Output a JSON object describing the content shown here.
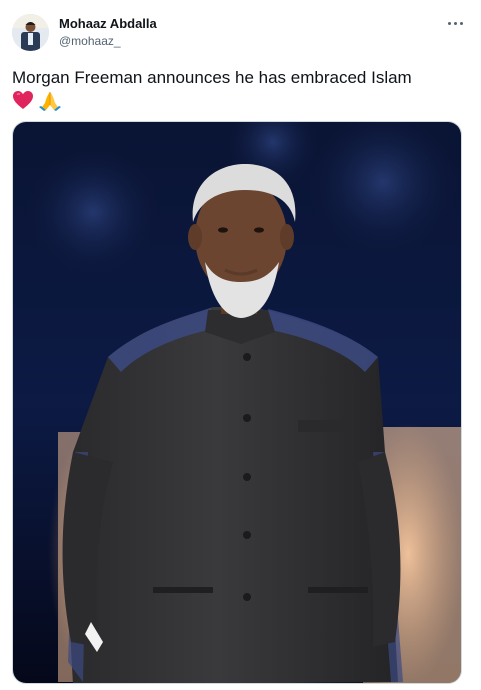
{
  "tweet": {
    "author_name": "Mohaaz Abdalla",
    "author_handle": "@mohaaz_",
    "text": "Morgan Freeman announces he has embraced Islam",
    "emojis": [
      "heart-emoji",
      "folded-hands-emoji"
    ]
  },
  "colors": {
    "text_primary": "#0f1419",
    "text_secondary": "#536471",
    "border": "#cfd9de",
    "heart": "#e0245e",
    "praying_hands": "#ffb300"
  },
  "icons": {
    "more": "ellipsis-icon"
  }
}
